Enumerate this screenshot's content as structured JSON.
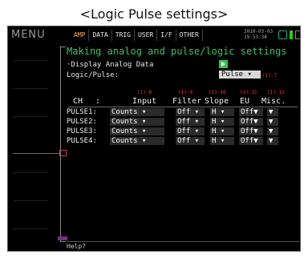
{
  "caption": "<Logic Pulse settings>",
  "menu_label": "MENU",
  "tabs": [
    {
      "label": "AMP",
      "active": true
    },
    {
      "label": "DATA",
      "active": false
    },
    {
      "label": "TRIG",
      "active": false
    },
    {
      "label": "USER",
      "active": false
    },
    {
      "label": "I/F",
      "active": false
    },
    {
      "label": "OTHER",
      "active": false
    }
  ],
  "datetime": {
    "date": "2010-03-03",
    "time": "19:53:38"
  },
  "panel": {
    "title": "Making analog and pulse/logic settings",
    "display_analog_label": "·Display Analog Data",
    "logic_pulse_label": "Logic/Pulse:",
    "logic_pulse_value": "Pulse ▾",
    "logic_pulse_tag": "(1)-7"
  },
  "column_tags": [
    "(1)-8",
    "(1)-9",
    "(1)-10",
    "(1)-11",
    "(1)-12"
  ],
  "columns": [
    "CH",
    ":",
    "Input",
    "Filter",
    "Slope",
    "EU",
    "Misc."
  ],
  "rows": [
    {
      "ch": "PULSE1:",
      "input": "Counts ▾",
      "filter": "Off ▾",
      "slope": "H ▾",
      "eu": "Off▼",
      "misc": "▼"
    },
    {
      "ch": "PULSE2:",
      "input": "Counts ▾",
      "filter": "Off ▾",
      "slope": "H ▾",
      "eu": "Off▼",
      "misc": "▼"
    },
    {
      "ch": "PULSE3:",
      "input": "Counts ▾",
      "filter": "Off ▾",
      "slope": "H ▾",
      "eu": "Off▼",
      "misc": "▼"
    },
    {
      "ch": "PULSE4:",
      "input": "Counts ▾",
      "filter": "Off ▾",
      "slope": "H ▾",
      "eu": "Off▼",
      "misc": "▼"
    }
  ],
  "footer": "Help?",
  "colors": {
    "title": "#36c36a",
    "tag": "#ff3b30",
    "active_tab": "#ffb060",
    "wave": "#d04050"
  }
}
